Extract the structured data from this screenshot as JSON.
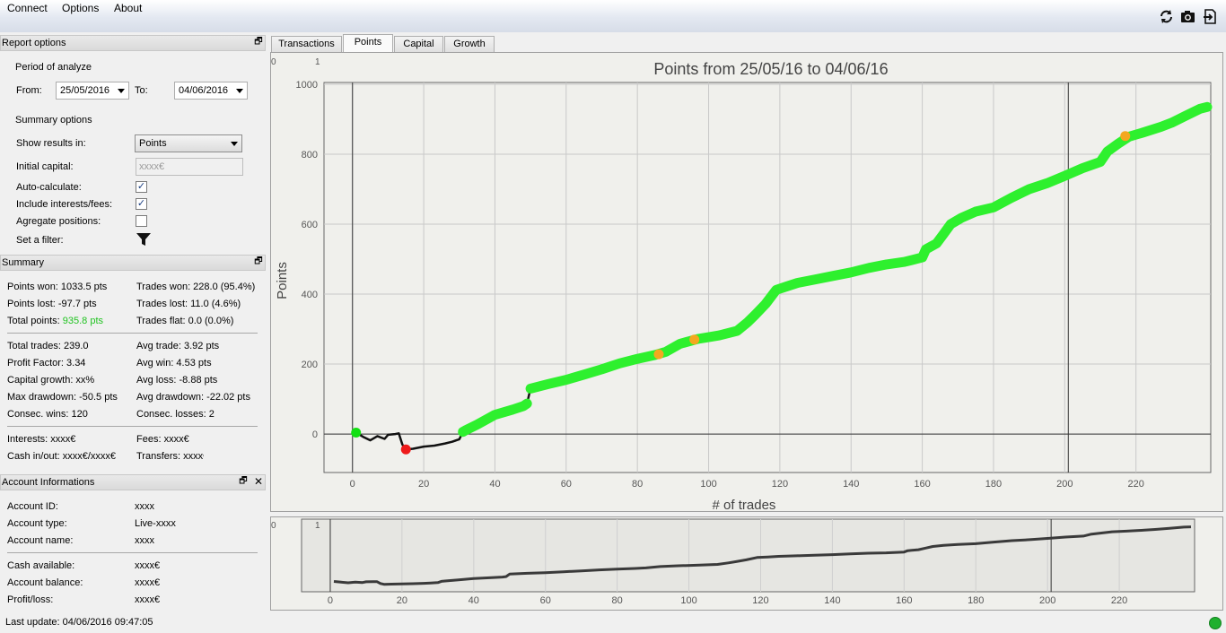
{
  "menu": {
    "items": [
      "Connect",
      "Options",
      "About"
    ]
  },
  "toolbar": {
    "icons": [
      "refresh-icon",
      "camera-icon",
      "export-icon"
    ]
  },
  "report_options": {
    "title": "Report options",
    "period_label": "Period of analyze",
    "from_label": "From:",
    "from_value": "25/05/2016",
    "to_label": "To:",
    "to_value": "04/06/2016",
    "summary_options_label": "Summary options",
    "show_results_label": "Show results in:",
    "show_results_value": "Points",
    "initial_capital_label": "Initial capital:",
    "initial_capital_placeholder": "xxxx€",
    "auto_calc_label": "Auto-calculate:",
    "auto_calc_checked": true,
    "include_fees_label": "Include interests/fees:",
    "include_fees_checked": true,
    "aggregate_label": "Agregate positions:",
    "aggregate_checked": false,
    "filter_label": "Set a filter:"
  },
  "summary": {
    "title": "Summary",
    "points_won": "Points won: 1033.5 pts",
    "points_lost": "Points lost: -97.7 pts",
    "total_points_label": "Total points: ",
    "total_points_value": "935.8 pts",
    "total_points_color": "#22c322",
    "trades_won": "Trades won: 228.0 (95.4%)",
    "trades_lost": "Trades lost: 11.0 (4.6%)",
    "trades_flat": "Trades flat: 0.0 (0.0%)",
    "total_trades": "Total trades: 239.0",
    "profit_factor": "Profit Factor: 3.34",
    "capital_growth": "Capital growth: xx%",
    "max_drawdown": "Max drawdown: -50.5 pts",
    "consec_wins": "Consec. wins: 120",
    "avg_trade": "Avg trade: 3.92 pts",
    "avg_win": "Avg win: 4.53 pts",
    "avg_loss": "Avg loss: -8.88 pts",
    "avg_drawdown": "Avg drawdown: -22.02 pts",
    "consec_losses": "Consec. losses: 2",
    "interests": "Interests: xxxx€",
    "fees": "Fees: xxxx€",
    "cash_inout": "Cash in/out: xxxx€/xxxx€",
    "transfers": "Transfers: xxxx€"
  },
  "account": {
    "title": "Account Informations",
    "rows1": [
      {
        "label": "Account ID:",
        "value": "xxxx"
      },
      {
        "label": "Account type:",
        "value": "Live-xxxx"
      },
      {
        "label": "Account name:",
        "value": "xxxx"
      }
    ],
    "rows2": [
      {
        "label": "Cash available:",
        "value": "xxxx€"
      },
      {
        "label": "Account balance:",
        "value": "xxxx€"
      },
      {
        "label": "Profit/loss:",
        "value": "xxxx€"
      }
    ]
  },
  "status": {
    "last_update": "Last update: 04/06/2016 09:47:05",
    "connection_color": "#1fb02e"
  },
  "tabs": [
    {
      "label": "Transactions",
      "active": false
    },
    {
      "label": "Points",
      "active": true
    },
    {
      "label": "Capital",
      "active": false
    },
    {
      "label": "Growth",
      "active": false
    }
  ],
  "chart_data": {
    "type": "line",
    "title": "Points from 25/05/16 to 04/06/16",
    "xlabel": "# of trades",
    "ylabel": "Points",
    "xlim": [
      -8,
      241
    ],
    "ylim": [
      -110,
      1005
    ],
    "xticks": [
      0,
      20,
      40,
      60,
      80,
      100,
      120,
      140,
      160,
      180,
      200,
      220
    ],
    "yticks": [
      0,
      200,
      400,
      600,
      800,
      1000
    ],
    "corner_labels": [
      "0",
      "1"
    ],
    "grid": true,
    "vertical_markers": [
      0,
      201
    ],
    "series": [
      {
        "points": [
          [
            1,
            4
          ],
          [
            3,
            -8
          ],
          [
            5,
            -18
          ],
          [
            7,
            -6
          ],
          [
            9,
            -14
          ],
          [
            10,
            -2
          ],
          [
            12,
            0
          ],
          [
            13,
            2
          ],
          [
            14,
            -30
          ],
          [
            15,
            -44
          ],
          [
            17,
            -42
          ],
          [
            20,
            -36
          ],
          [
            23,
            -33
          ],
          [
            26,
            -27
          ],
          [
            28,
            -22
          ],
          [
            30,
            -15
          ],
          [
            31,
            6
          ],
          [
            32,
            12
          ],
          [
            35,
            27
          ],
          [
            40,
            55
          ],
          [
            45,
            70
          ],
          [
            48,
            80
          ],
          [
            49,
            87
          ],
          [
            50,
            130
          ],
          [
            55,
            143
          ],
          [
            60,
            155
          ],
          [
            65,
            170
          ],
          [
            70,
            185
          ],
          [
            75,
            202
          ],
          [
            80,
            215
          ],
          [
            85,
            226
          ],
          [
            88,
            235
          ],
          [
            92,
            258
          ],
          [
            97,
            272
          ],
          [
            103,
            282
          ],
          [
            108,
            295
          ],
          [
            111,
            320
          ],
          [
            113,
            340
          ],
          [
            116,
            372
          ],
          [
            119,
            412
          ],
          [
            122,
            422
          ],
          [
            125,
            432
          ],
          [
            130,
            442
          ],
          [
            135,
            452
          ],
          [
            140,
            462
          ],
          [
            145,
            475
          ],
          [
            150,
            485
          ],
          [
            155,
            492
          ],
          [
            160,
            505
          ],
          [
            161,
            528
          ],
          [
            164,
            545
          ],
          [
            166,
            572
          ],
          [
            168,
            600
          ],
          [
            171,
            618
          ],
          [
            175,
            636
          ],
          [
            180,
            648
          ],
          [
            185,
            675
          ],
          [
            190,
            700
          ],
          [
            195,
            717
          ],
          [
            200,
            738
          ],
          [
            205,
            760
          ],
          [
            210,
            778
          ],
          [
            212,
            808
          ],
          [
            215,
            830
          ],
          [
            218,
            850
          ],
          [
            222,
            862
          ],
          [
            227,
            878
          ],
          [
            230,
            890
          ],
          [
            234,
            910
          ],
          [
            238,
            930
          ],
          [
            240,
            935
          ]
        ]
      }
    ],
    "markers": [
      {
        "x": 1,
        "y": 4,
        "color": "#13e013"
      },
      {
        "x": 15,
        "y": -44,
        "color": "#ee1b1b"
      },
      {
        "x": 86,
        "y": 228,
        "color": "#f4a81f"
      },
      {
        "x": 96,
        "y": 270,
        "color": "#f4a81f"
      },
      {
        "x": 217,
        "y": 852,
        "color": "#f4a81f"
      }
    ]
  },
  "navigator": {
    "xticks": [
      0,
      20,
      40,
      60,
      80,
      100,
      120,
      140,
      160,
      180,
      200,
      220
    ],
    "corner_labels": [
      "0",
      "1"
    ]
  }
}
